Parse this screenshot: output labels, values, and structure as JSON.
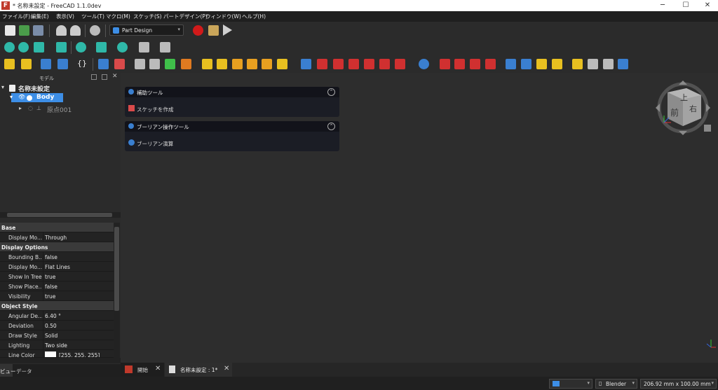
{
  "window": {
    "title": "* 名称未設定 - FreeCAD 1.1.0dev",
    "logo": "F"
  },
  "menu": [
    "ファイル(F)",
    "編集(E)",
    "表示(V)",
    "ツール(T)",
    "マクロ(M)",
    "スケッチ(S)",
    "パートデザイン(P)",
    "ウィンドウ(W)",
    "ヘルプ(H)"
  ],
  "toolbar": {
    "workbench": "Part Design"
  },
  "model": {
    "title": "モデル",
    "document": "名称未設定",
    "body": "Body",
    "origin": "原点001"
  },
  "properties": [
    {
      "group": "Base"
    },
    {
      "name": "Display Mo...",
      "value": "Through"
    },
    {
      "group": "Display Options"
    },
    {
      "name": "Bounding B...",
      "value": "false"
    },
    {
      "name": "Display Mo...",
      "value": "Flat Lines"
    },
    {
      "name": "Show In Tree",
      "value": "true"
    },
    {
      "name": "Show Place...",
      "value": "false"
    },
    {
      "name": "Visibility",
      "value": "true"
    },
    {
      "group": "Object Style"
    },
    {
      "name": "Angular De...",
      "value": "6.40 °"
    },
    {
      "name": "Deviation",
      "value": "0.50"
    },
    {
      "name": "Draw Style",
      "value": "Solid"
    },
    {
      "name": "Lighting",
      "value": "Two side"
    },
    {
      "name": "Line Color",
      "value": "[255, 255, 255]"
    }
  ],
  "left_tabs": [
    "ビュー",
    "データ"
  ],
  "task_panels": [
    {
      "title": "補助ツール",
      "item": "スケッチを作成"
    },
    {
      "title": "ブーリアン操作ツール",
      "item": "ブーリアン演算"
    }
  ],
  "navcube": {
    "top": "上",
    "front": "前",
    "right": "右"
  },
  "doc_tabs": [
    "開始",
    "名称未設定 : 1*"
  ],
  "status": {
    "navigation": "Blender",
    "dimensions": "206.92 mm x 100.00 mm"
  },
  "colors": {
    "accent": "#3d8ee6",
    "record": "#d11a1a",
    "panel": "#1b1d25"
  }
}
